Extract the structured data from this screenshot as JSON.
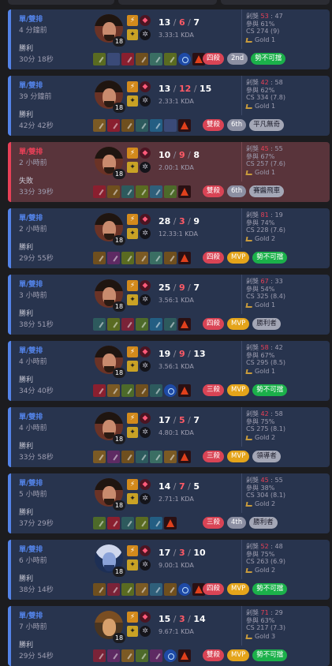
{
  "matches": [
    {
      "queue": "單/雙排",
      "ago": "4 分鐘前",
      "result": "勝利",
      "duration": "30分 18秒",
      "outcome": "win",
      "champion": {
        "portrait": "bearded-warrior",
        "level": "18"
      },
      "kills": "13",
      "deaths": "6",
      "assists": "7",
      "kda": "3.33:1 KDA",
      "items": [
        "sword-item",
        "empty-slot",
        "potion-item",
        "sword-item",
        "boots-item",
        "sword-item",
        "ward-item",
        "ward-item"
      ],
      "multikill": "四殺",
      "placement": "2nd",
      "tag": "勢不可擋",
      "tag_color": "green",
      "kill_participation": "53",
      "kill_participation_value": "47",
      "participation": "參與 61%",
      "cs": "CS 274 (9)",
      "rank": "Gold 1"
    },
    {
      "queue": "單/雙排",
      "ago": "39 分鐘前",
      "result": "勝利",
      "duration": "42分 42秒",
      "outcome": "win",
      "champion": {
        "portrait": "bearded-warrior",
        "level": "18"
      },
      "kills": "13",
      "deaths": "12",
      "assists": "15",
      "kda": "2.33:1 KDA",
      "items": [
        "sword-item",
        "potion-item",
        "sword-item",
        "sword-item",
        "boots-item",
        "empty-slot",
        "ward-item"
      ],
      "multikill": "雙殺",
      "placement": "6th",
      "tag": "平凡無奇",
      "tag_color": "gray",
      "kill_participation": "42",
      "kill_participation_value": "58",
      "participation": "參與 62%",
      "cs": "CS 334 (7.8)",
      "rank": "Gold 1"
    },
    {
      "queue": "單/雙排",
      "ago": "2 小時前",
      "result": "失敗",
      "duration": "33分 39秒",
      "outcome": "loss",
      "champion": {
        "portrait": "bearded-warrior",
        "level": "18"
      },
      "kills": "10",
      "deaths": "9",
      "assists": "8",
      "kda": "2.00:1 KDA",
      "items": [
        "potion-item",
        "sword-item",
        "sword-item",
        "sword-item",
        "boots-item",
        "sword-item",
        "ward-item"
      ],
      "multikill": "雙殺",
      "placement": "6th",
      "tag": "賽醬飛車",
      "tag_color": "gray",
      "kill_participation": "45",
      "kill_participation_value": "55",
      "participation": "參與 67%",
      "cs": "CS 257 (7.6)",
      "rank": "Gold 1"
    },
    {
      "queue": "單/雙排",
      "ago": "2 小時前",
      "result": "勝利",
      "duration": "29分 55秒",
      "outcome": "win",
      "champion": {
        "portrait": "bearded-warrior",
        "level": "18"
      },
      "kills": "28",
      "deaths": "3",
      "assists": "9",
      "kda": "12.33:1 KDA",
      "items": [
        "sword-item",
        "potion-item",
        "sword-item",
        "sword-item",
        "boots-item",
        "sword-item",
        "ward-item"
      ],
      "multikill": "四殺",
      "placement": "MVP",
      "tag": "勢不可擋",
      "tag_color": "green",
      "kill_participation": "81",
      "kill_participation_value": "19",
      "participation": "參與 74%",
      "cs": "CS 228 (7.6)",
      "rank": "Gold 2"
    },
    {
      "queue": "單/雙排",
      "ago": "3 小時前",
      "result": "勝利",
      "duration": "38分 51秒",
      "outcome": "win",
      "champion": {
        "portrait": "bearded-warrior",
        "level": "18"
      },
      "kills": "25",
      "deaths": "9",
      "assists": "7",
      "kda": "3.56:1 KDA",
      "items": [
        "sword-item",
        "sword-item",
        "potion-item",
        "sword-item",
        "boots-item",
        "sword-item",
        "ward-item"
      ],
      "multikill": "四殺",
      "placement": "MVP",
      "tag": "勝利者",
      "tag_color": "gray",
      "kill_participation": "67",
      "kill_participation_value": "33",
      "participation": "參與 54%",
      "cs": "CS 325 (8.4)",
      "rank": "Gold 1"
    },
    {
      "queue": "單/雙排",
      "ago": "4 小時前",
      "result": "勝利",
      "duration": "34分 40秒",
      "outcome": "win",
      "champion": {
        "portrait": "bearded-warrior",
        "level": "18"
      },
      "kills": "19",
      "deaths": "9",
      "assists": "13",
      "kda": "3.56:1 KDA",
      "items": [
        "potion-item",
        "sword-item",
        "sword-item",
        "sword-item",
        "sword-item",
        "ward-item",
        "ward-item"
      ],
      "multikill": "三殺",
      "placement": "MVP",
      "tag": "勢不可擋",
      "tag_color": "green",
      "kill_participation": "58",
      "kill_participation_value": "42",
      "participation": "參與 67%",
      "cs": "CS 295 (8.5)",
      "rank": "Gold 1"
    },
    {
      "queue": "單/雙排",
      "ago": "4 小時前",
      "result": "勝利",
      "duration": "33分 58秒",
      "outcome": "win",
      "champion": {
        "portrait": "bearded-warrior",
        "level": "18"
      },
      "kills": "17",
      "deaths": "5",
      "assists": "7",
      "kda": "4.80:1 KDA",
      "items": [
        "sword-item",
        "potion-item",
        "sword-item",
        "sword-item",
        "boots-item",
        "sword-item",
        "ward-item"
      ],
      "multikill": "三殺",
      "placement": "MVP",
      "tag": "領導者",
      "tag_color": "gray",
      "kill_participation": "42",
      "kill_participation_value": "58",
      "participation": "參與 75%",
      "cs": "CS 275 (8.1)",
      "rank": "Gold 2"
    },
    {
      "queue": "單/雙排",
      "ago": "5 小時前",
      "result": "勝利",
      "duration": "37分 29秒",
      "outcome": "win",
      "champion": {
        "portrait": "bearded-warrior",
        "level": "18"
      },
      "kills": "14",
      "deaths": "7",
      "assists": "5",
      "kda": "2.71:1 KDA",
      "items": [
        "sword-item",
        "potion-item",
        "sword-item",
        "sword-item",
        "boots-item",
        "ward-item"
      ],
      "multikill": "三殺",
      "placement": "4th",
      "tag": "勝利者",
      "tag_color": "gray",
      "kill_participation": "45",
      "kill_participation_value": "55",
      "participation": "參與 38%",
      "cs": "CS 304 (8.1)",
      "rank": "Gold 2"
    },
    {
      "queue": "單/雙排",
      "ago": "6 小時前",
      "result": "勝利",
      "duration": "38分 14秒",
      "outcome": "win",
      "champion": {
        "portrait": "white-haired-mage",
        "level": "18"
      },
      "kills": "17",
      "deaths": "3",
      "assists": "10",
      "kda": "9.00:1 KDA",
      "items": [
        "sword-item",
        "potion-item",
        "sword-item",
        "sword-item",
        "boots-item",
        "sword-item",
        "ward-item",
        "ward-item"
      ],
      "multikill": "四殺",
      "placement": "MVP",
      "tag": "勢不可擋",
      "tag_color": "green",
      "kill_participation": "52",
      "kill_participation_value": "48",
      "participation": "參與 75%",
      "cs": "CS 263 (6.9)",
      "rank": "Gold 2"
    },
    {
      "queue": "單/雙排",
      "ago": "7 小時前",
      "result": "勝利",
      "duration": "29分 54秒",
      "outcome": "win",
      "champion": {
        "portrait": "long-haired-fighter",
        "level": "18"
      },
      "kills": "15",
      "deaths": "3",
      "assists": "14",
      "kda": "9.67:1 KDA",
      "items": [
        "potion-item",
        "potion-item",
        "sword-item",
        "sword-item",
        "potion-item",
        "ward-item",
        "ward-item"
      ],
      "multikill": "雙殺",
      "placement": "MVP",
      "tag": "勢不可擋",
      "tag_color": "green",
      "kill_participation": "71",
      "kill_participation_value": "29",
      "participation": "參與 63%",
      "cs": "CS 217 (7.3)",
      "rank": "Gold 3"
    }
  ],
  "colors": {
    "win_bg": "#28344e",
    "loss_bg": "#59343b",
    "win_accent": "#5383e8",
    "loss_accent": "#e84057"
  }
}
